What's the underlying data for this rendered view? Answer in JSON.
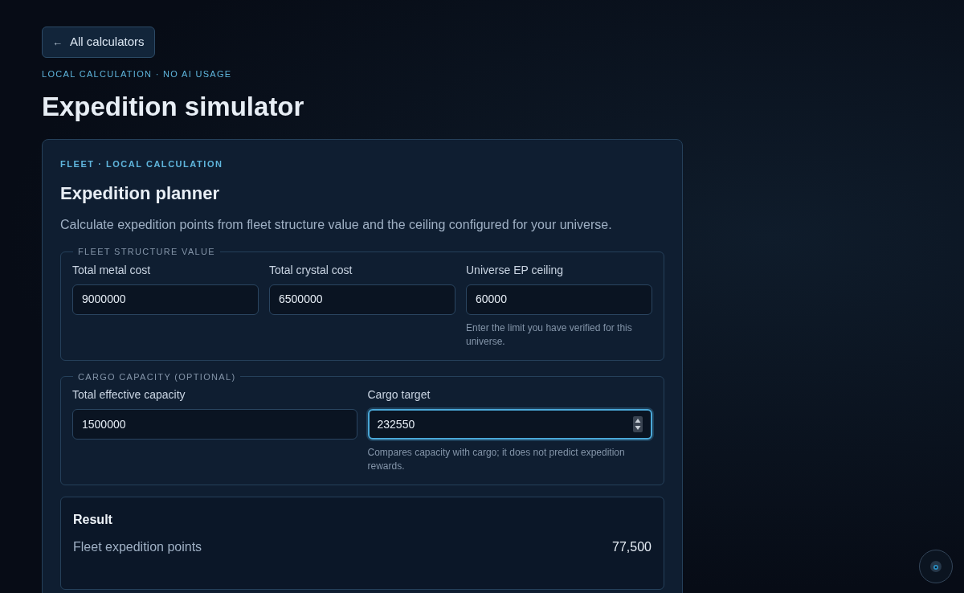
{
  "back_button": {
    "label": "All calculators",
    "icon": "←"
  },
  "eyebrow": "LOCAL CALCULATION · NO AI USAGE",
  "title": "Expedition simulator",
  "card": {
    "eyebrow": "FLEET · LOCAL CALCULATION",
    "title": "Expedition planner",
    "description": "Calculate expedition points from fleet structure value and the ceiling configured for your universe.",
    "groups": [
      {
        "legend": "FLEET STRUCTURE VALUE",
        "fields": [
          {
            "label": "Total metal cost",
            "value": "9000000",
            "focused": false
          },
          {
            "label": "Total crystal cost",
            "value": "6500000",
            "focused": false
          },
          {
            "label": "Universe EP ceiling",
            "value": "60000",
            "focused": false,
            "hint": "Enter the limit you have verified for this universe."
          }
        ]
      },
      {
        "legend": "CARGO CAPACITY (OPTIONAL)",
        "fields": [
          {
            "label": "Total effective capacity",
            "value": "1500000",
            "focused": false
          },
          {
            "label": "Cargo target",
            "value": "232550",
            "focused": true,
            "hint": "Compares capacity with cargo; it does not predict expedition rewards."
          }
        ]
      }
    ],
    "result": {
      "title": "Result",
      "rows": [
        {
          "label": "Fleet expedition points",
          "value": "77,500"
        }
      ]
    }
  }
}
